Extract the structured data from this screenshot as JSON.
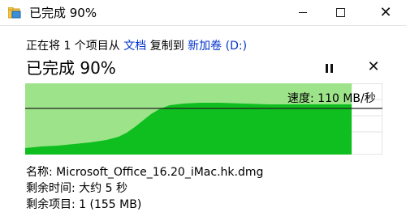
{
  "window": {
    "title": "已完成 90%",
    "icon": "folder-copy-icon",
    "controls": {
      "minimize": "minimize-icon",
      "maximize": "maximize-icon",
      "close": "close-icon",
      "close_glyph": "✕"
    }
  },
  "copy": {
    "line_prefix": "正在将 1 个项目从",
    "source": "文档",
    "line_middle": "复制到",
    "destination": "新加卷 (D:)",
    "status": "已完成 90%",
    "pause_icon": "pause-icon",
    "cancel_icon": "close-icon",
    "cancel_glyph": "✕",
    "percent_complete": 90,
    "speed_label": "速度: 110 MB/秒"
  },
  "details": {
    "name_label": "名称:",
    "name_value": "Microsoft_Office_16.20_iMac.hk.dmg",
    "time_label": "剩余时间:",
    "time_value": "大约 5 秒",
    "items_label": "剩余项目:",
    "items_value": "1 (155 MB)"
  },
  "colors": {
    "graph_fill_light": "#9de38a",
    "graph_fill_dark": "#0fbf1f",
    "graph_line": "#222222",
    "link": "#0033cc"
  }
}
